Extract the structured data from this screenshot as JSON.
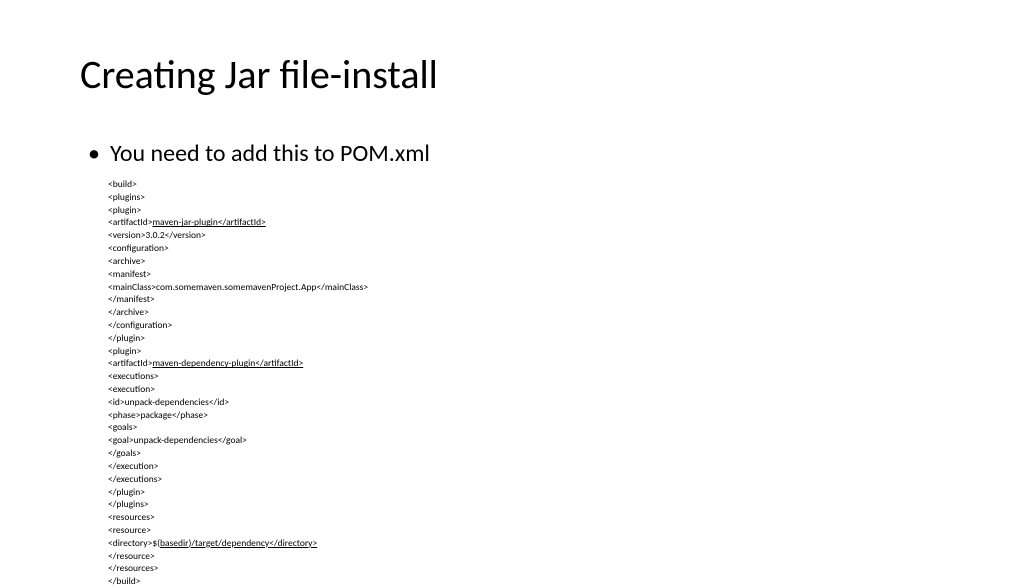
{
  "title": "Creating Jar file-install",
  "bullet": "You need to add this to POM.xml",
  "code": {
    "l1": "<build>",
    "l2": "<plugins>",
    "l3": "<plugin>",
    "l4a": "<artifactId>",
    "l4b": "maven-jar-plugin</artifactId>",
    "l5": "<version>3.0.2</version>",
    "l6": "<configuration>",
    "l7": "<archive>",
    "l8": "<manifest>",
    "l9": "<mainClass>com.somemaven.somemavenProject.App</mainClass>",
    "l10": "</manifest>",
    "l11": "</archive>",
    "l12": "</configuration>",
    "l13": "</plugin>",
    "l14": "<plugin>",
    "l15a": "<artifactId>",
    "l15b": "maven-dependency-plugin</artifactId>",
    "l16": "<executions>",
    "l17": "<execution>",
    "l18": "<id>unpack-dependencies</id>",
    "l19": "<phase>package</phase>",
    "l20": "<goals>",
    "l21": "<goal>unpack-dependencies</goal>",
    "l22": "</goals>",
    "l23": "</execution>",
    "l24": "</executions>",
    "l25": "</plugin>",
    "l26": "</plugins>",
    "l27": "<resources>",
    "l28": "<resource>",
    "l29a": "<directory>$(",
    "l29b": "basedir)/target/dependency</directory>",
    "l30": "</resource>",
    "l31": "</resources>",
    "l32": "</build>"
  }
}
